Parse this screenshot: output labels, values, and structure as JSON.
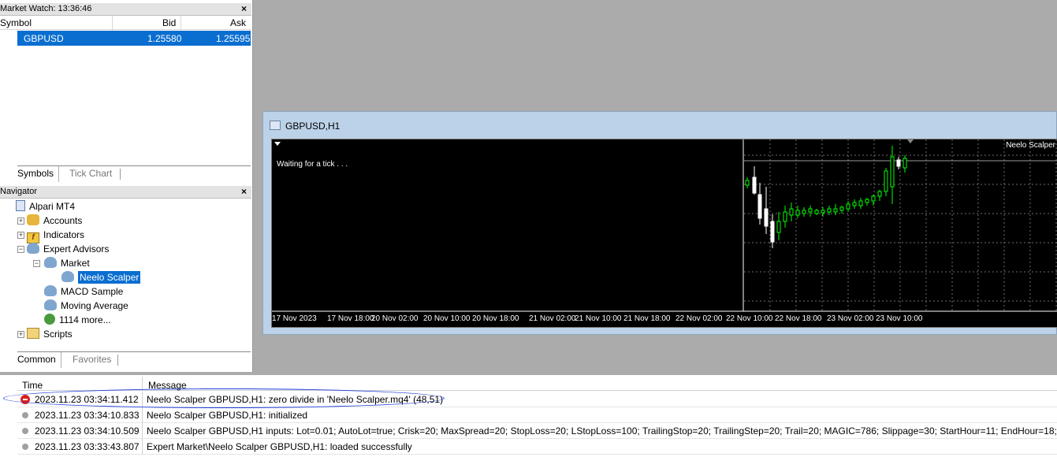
{
  "market_watch": {
    "title": "Market Watch: 13:36:46",
    "col_symbol": "Symbol",
    "col_bid": "Bid",
    "col_ask": "Ask",
    "rows": [
      {
        "symbol": "GBPUSD",
        "bid": "1.25580",
        "ask": "1.25595"
      }
    ],
    "tabs": [
      "Symbols",
      "Tick Chart"
    ]
  },
  "navigator": {
    "title": "Navigator",
    "items": [
      "Alpari MT4",
      "Accounts",
      "Indicators",
      "Expert Advisors",
      "Market",
      "Neelo Scalper",
      "MACD Sample",
      "Moving Average",
      "1114 more...",
      "Scripts"
    ],
    "tabs": [
      "Common",
      "Favorites"
    ]
  },
  "chart": {
    "title": "GBPUSD,H1",
    "status": "Waiting for a tick . . .",
    "ea_label": "Neelo Scalper",
    "x_ticks": [
      "17 Nov 2023",
      "17 Nov 18:00",
      "20 Nov 02:00",
      "20 Nov 10:00",
      "20 Nov 18:00",
      "21 Nov 02:00",
      "21 Nov 10:00",
      "21 Nov 18:00",
      "22 Nov 02:00",
      "22 Nov 10:00",
      "22 Nov 18:00",
      "23 Nov 02:00",
      "23 Nov 10:00"
    ],
    "colors": {
      "bull": "#00ff00",
      "bear": "#ffffff",
      "grid": "#6e6e6e"
    }
  },
  "log": {
    "col_time": "Time",
    "col_message": "Message",
    "rows": [
      {
        "time": "2023.11.23 03:34:11.412",
        "message": "Neelo Scalper GBPUSD,H1: zero divide in 'Neelo Scalper.mq4' (48,51)",
        "level": "error"
      },
      {
        "time": "2023.11.23 03:34:10.833",
        "message": "Neelo Scalper GBPUSD,H1: initialized",
        "level": "info"
      },
      {
        "time": "2023.11.23 03:34:10.509",
        "message": "Neelo Scalper GBPUSD,H1 inputs: Lot=0.01; AutoLot=true; Crisk=20; MaxSpread=20; StopLoss=20; LStopLoss=100; TrailingStop=20; TrailingStep=20; Trail=20; MAGIC=786; Slippage=30; StartHour=11; EndHour=18;",
        "level": "info"
      },
      {
        "time": "2023.11.23 03:33:43.807",
        "message": "Expert Market\\Neelo Scalper GBPUSD,H1: loaded successfully",
        "level": "info"
      }
    ]
  }
}
